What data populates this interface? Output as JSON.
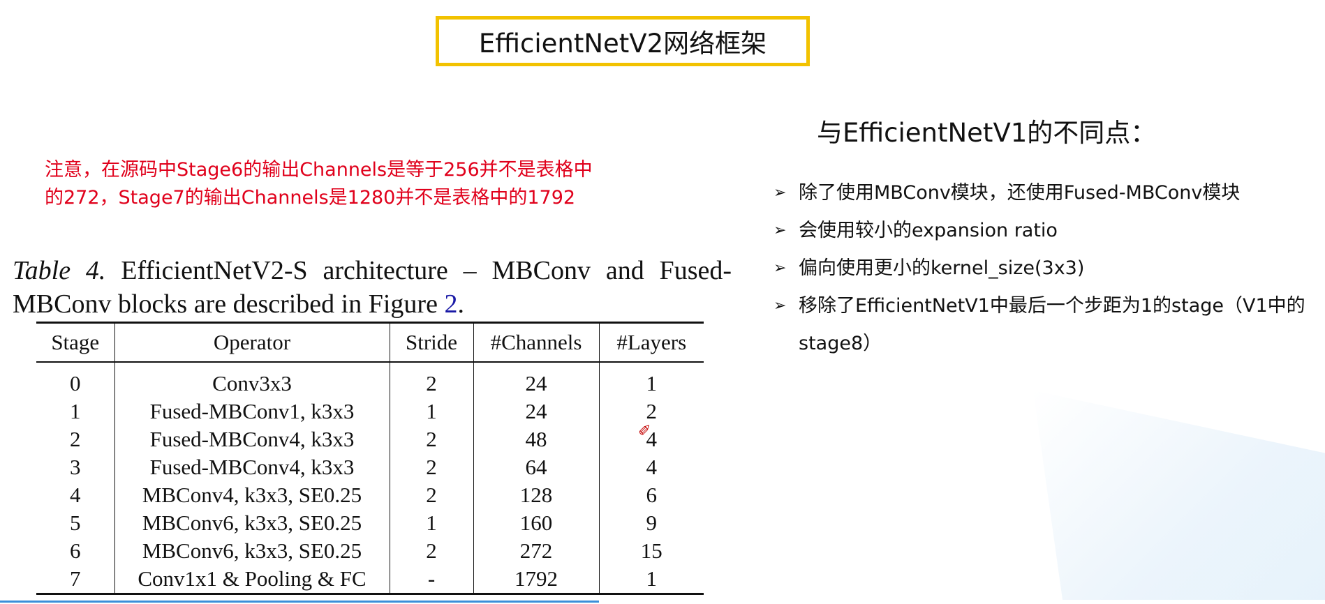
{
  "slide": {
    "title": "EfficientNetV2网络框架",
    "note_line1": "注意，在源码中Stage6的输出Channels是等于256并不是表格中",
    "note_line2": "的272，Stage7的输出Channels是1280并不是表格中的1792",
    "caption": {
      "lead": "Table 4.",
      "body": " EfficientNetV2-S architecture – MBConv and Fused-MBConv blocks are described in Figure ",
      "ref": "2",
      "end": "."
    },
    "table": {
      "headers": [
        "Stage",
        "Operator",
        "Stride",
        "#Channels",
        "#Layers"
      ],
      "rows": [
        [
          "0",
          "Conv3x3",
          "2",
          "24",
          "1"
        ],
        [
          "1",
          "Fused-MBConv1, k3x3",
          "1",
          "24",
          "2"
        ],
        [
          "2",
          "Fused-MBConv4, k3x3",
          "2",
          "48",
          "4"
        ],
        [
          "3",
          "Fused-MBConv4, k3x3",
          "2",
          "64",
          "4"
        ],
        [
          "4",
          "MBConv4, k3x3, SE0.25",
          "2",
          "128",
          "6"
        ],
        [
          "5",
          "MBConv6, k3x3, SE0.25",
          "1",
          "160",
          "9"
        ],
        [
          "6",
          "MBConv6, k3x3, SE0.25",
          "2",
          "272",
          "15"
        ],
        [
          "7",
          "Conv1x1 & Pooling & FC",
          "-",
          "1792",
          "1"
        ]
      ]
    },
    "diff_title": "与EfficientNetV1的不同点：",
    "bullets": [
      "除了使用MBConv模块，还使用Fused-MBConv模块",
      "会使用较小的expansion ratio",
      "偏向使用更小的kernel_size(3x3)",
      "移除了EfficientNetV1中最后一个步距为1的stage（V1中的stage8）"
    ],
    "bullet_glyph": "➢"
  },
  "colors": {
    "title_border": "#f2c200",
    "note_text": "#e0001b",
    "figure_ref": "#1a1aa6"
  }
}
